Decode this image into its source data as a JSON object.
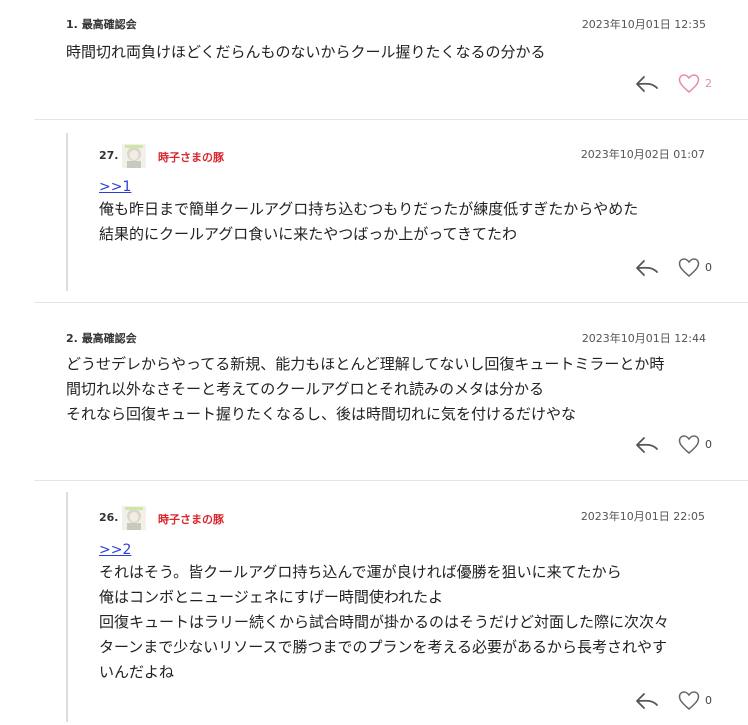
{
  "colors": {
    "username": "#d9262b",
    "link": "#2a3fd6",
    "heart_liked": "#e78aa8",
    "icon": "#555555",
    "divider": "#e6e6e6"
  },
  "comments": [
    {
      "number": "1.",
      "name": "最高確認会",
      "date": "2023年10月01日 12:35",
      "lines": [
        "時間切れ両負けほどくだらんものないからクール握りたくなるの分かる"
      ],
      "likes": "2",
      "reply_icon": "reply-arrow-icon",
      "heart_icon": "heart-icon"
    },
    {
      "number": "27.",
      "name": "時子さまの豚",
      "date": "2023年10月02日 01:07",
      "anchor": ">>1",
      "lines": [
        "俺も昨日まで簡単クールアグロ持ち込むつもりだったが練度低すぎたからやめた",
        "結果的にクールアグロ食いに来たやつばっか上がってきてたわ"
      ],
      "likes": "0"
    },
    {
      "number": "2.",
      "name": "最高確認会",
      "date": "2023年10月01日 12:44",
      "lines": [
        "どうせデレからやってる新規、能力もほとんど理解してないし回復キュートミラーとか時",
        "間切れ以外なさそーと考えてのクールアグロとそれ読みのメタは分かる",
        "それなら回復キュート握りたくなるし、後は時間切れに気を付けるだけやな"
      ],
      "likes": "0"
    },
    {
      "number": "26.",
      "name": "時子さまの豚",
      "date": "2023年10月01日 22:05",
      "anchor": ">>2",
      "lines": [
        "それはそう。皆クールアグロ持ち込んで運が良ければ優勝を狙いに来てたから",
        "俺はコンボとニュージェネにすげー時間使われたよ",
        "回復キュートはラリー続くから試合時間が掛かるのはそうだけど対面した際に次次々",
        "ターンまで少ないリソースで勝つまでのプランを考える必要があるから長考されやす",
        "いんだよね"
      ],
      "likes": "0"
    }
  ]
}
